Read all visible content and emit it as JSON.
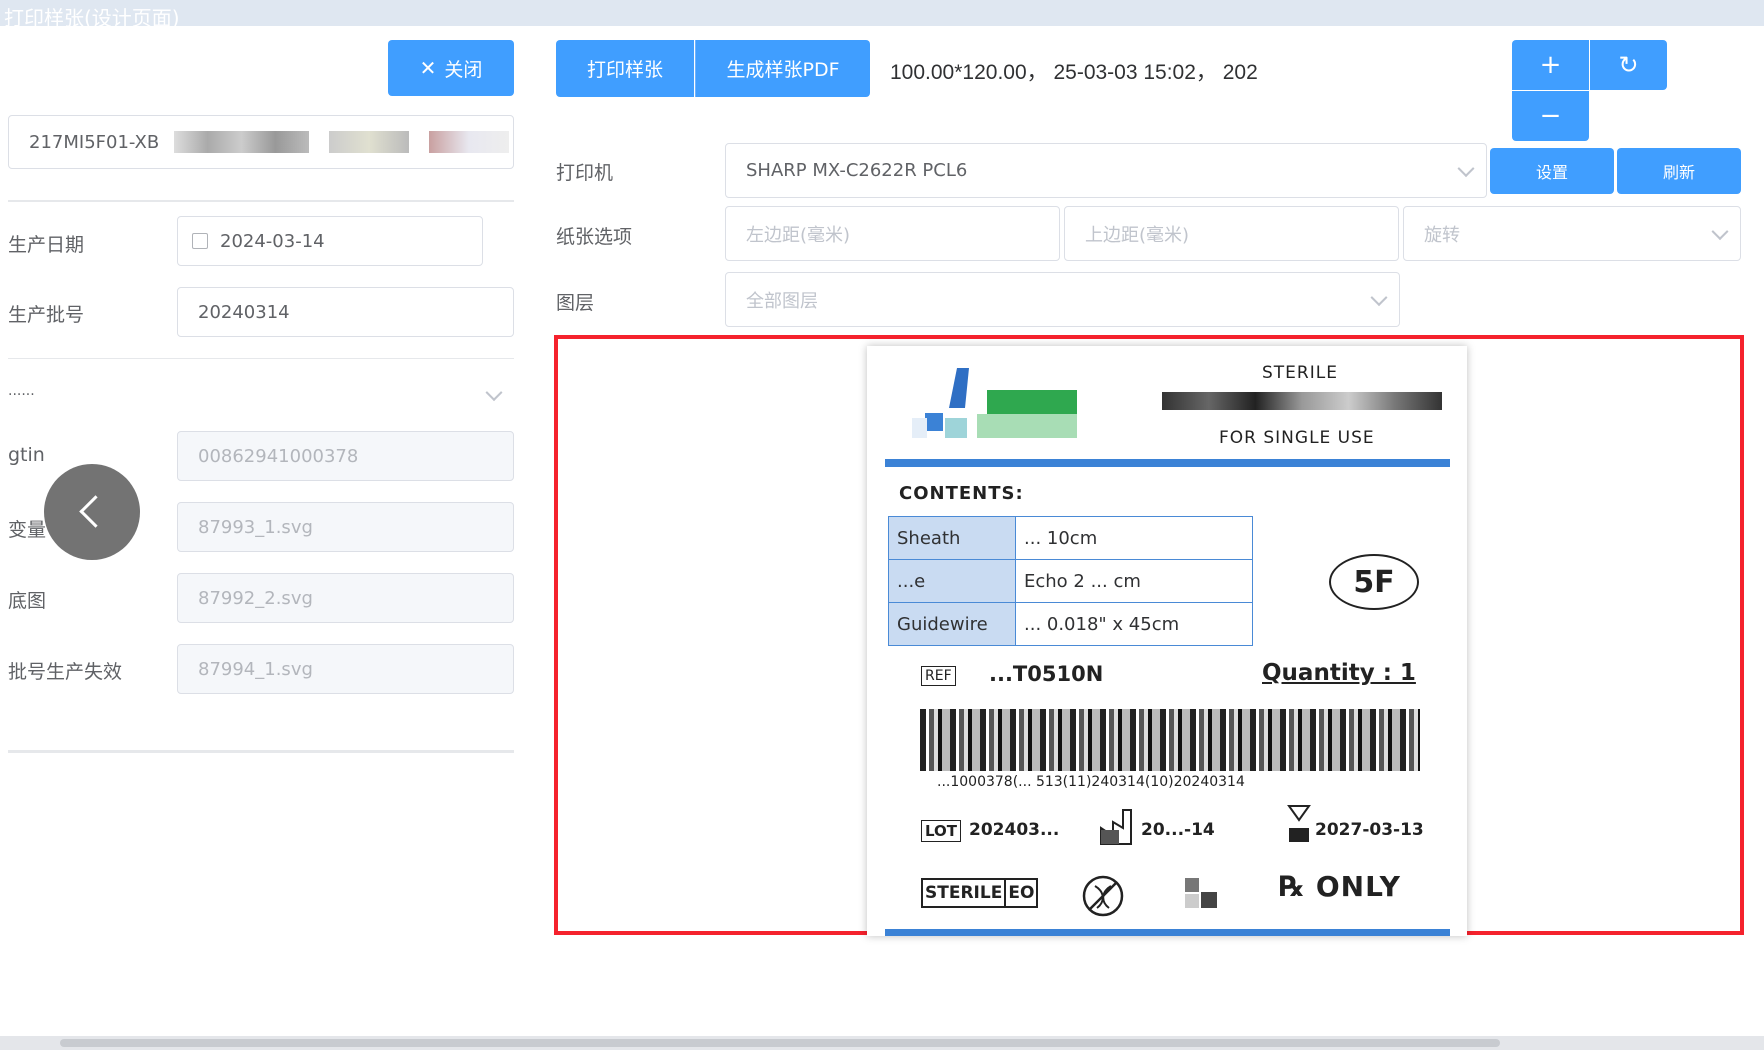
{
  "window": {
    "title": "打印样张(设计页面)"
  },
  "left_panel": {
    "close_button": "关闭",
    "product_code": "217MI5F01-XB",
    "fields": [
      {
        "label": "生产日期",
        "value": "2024-03-14"
      },
      {
        "label": "生产批号",
        "value": "20240314"
      }
    ],
    "collapse_label": "......",
    "readonly_fields": [
      {
        "label": "gtin",
        "value": "00862941000378"
      },
      {
        "label": "变量",
        "value": "87993_1.svg"
      },
      {
        "label": "底图",
        "value": "87992_2.svg"
      },
      {
        "label": "批号生产失效",
        "value": "87994_1.svg"
      }
    ]
  },
  "toolbar": {
    "print_sample": "打印样张",
    "generate_pdf": "生成样张PDF",
    "info": "100.00*120.00， 25-03-03 15:02， 202",
    "zoom_in": "+",
    "zoom_out": "−",
    "refresh_icon": "↻"
  },
  "settings": {
    "printer_label": "打印机",
    "printer_value": "SHARP MX-C2622R PCL6",
    "setup_button": "设置",
    "refresh_button": "刷新",
    "paper_label": "纸张选项",
    "left_margin_placeholder": "左边距(毫米)",
    "top_margin_placeholder": "上边距(毫米)",
    "rotate_placeholder": "旋转",
    "layer_label": "图层",
    "layer_placeholder": "全部图层"
  },
  "label_preview": {
    "sterile": "STERILE",
    "single_use": "FOR SINGLE USE",
    "contents_title": "CONTENTS:",
    "rows": [
      {
        "name": "Sheath",
        "value": "... 10cm"
      },
      {
        "name": "...e",
        "value": "Echo 2 ... cm"
      },
      {
        "name": "Guidewire",
        "value": "... 0.018\" x 45cm"
      }
    ],
    "size": "5F",
    "ref_label": "REF",
    "ref_value": "...T0510N",
    "quantity": "Quantity : 1",
    "barcode_text": "...1000378(... 513(11)240314(10)20240314",
    "lot_label": "LOT",
    "lot_value": "202403...",
    "mfg_date": "20...-14",
    "exp_date": "2027-03-13",
    "sterile_eo_a": "STERILE",
    "sterile_eo_b": "EO",
    "rx_only": "℞ ONLY"
  },
  "colors": {
    "accent": "#409eff",
    "highlight_border": "#f5222d",
    "label_blue": "#3b82d6",
    "logo_green": "#2fa84f"
  }
}
